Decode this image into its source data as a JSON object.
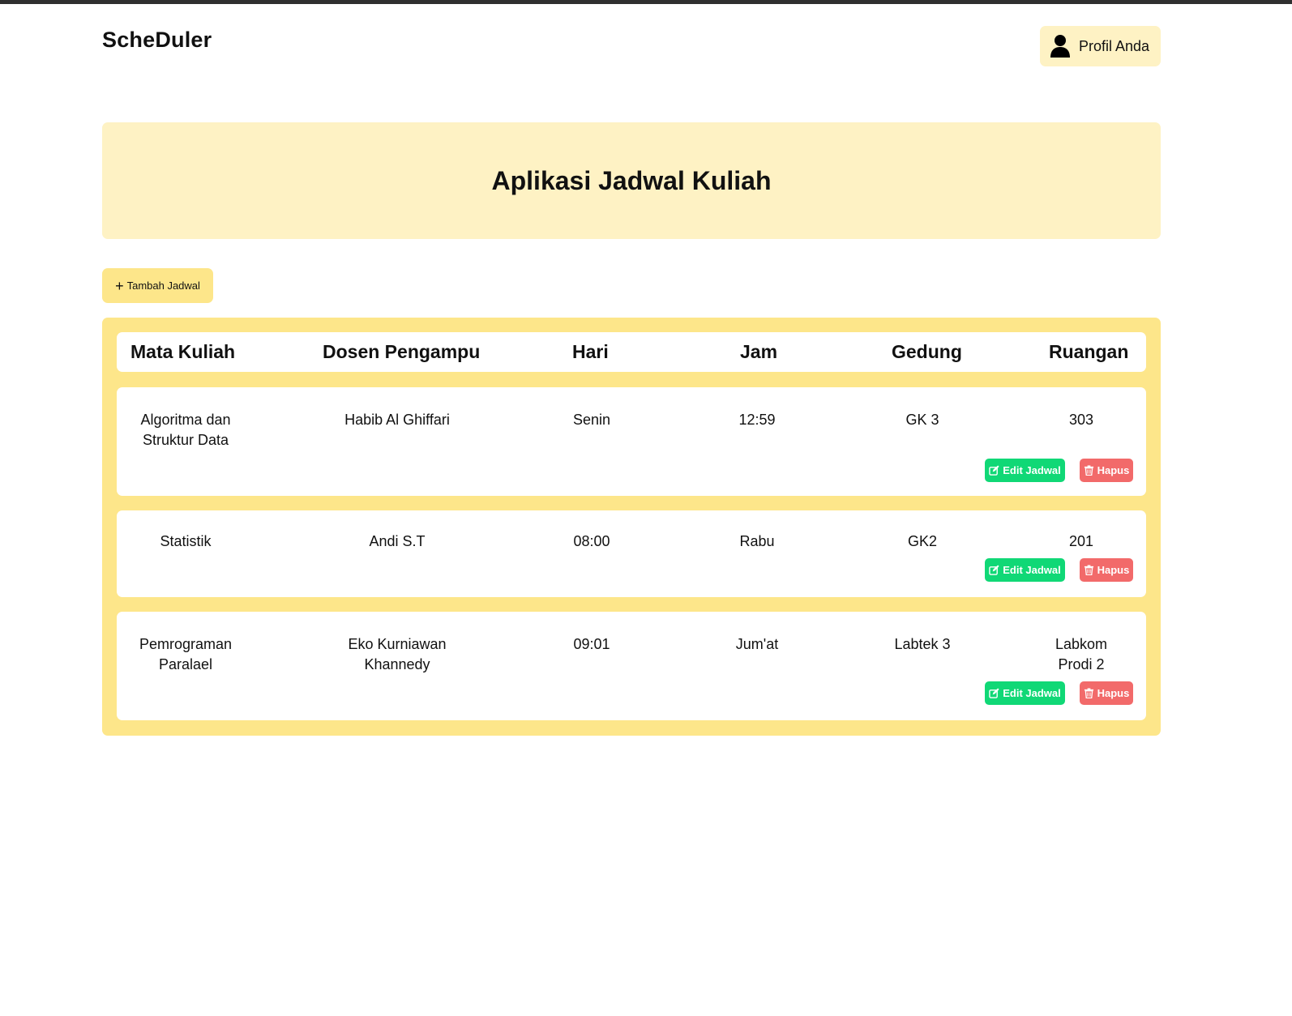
{
  "app": {
    "brand": "ScheDuler",
    "profile_label": "Profil Anda"
  },
  "hero": {
    "title": "Aplikasi Jadwal Kuliah"
  },
  "actions": {
    "add_label": "Tambah Jadwal"
  },
  "table": {
    "headers": [
      "Mata Kuliah",
      "Dosen Pengampu",
      "Hari",
      "Jam",
      "Gedung",
      "Ruangan"
    ],
    "rows": [
      {
        "cells": [
          "Algoritma dan Struktur Data",
          "Habib Al Ghiffari",
          "Senin",
          "12:59",
          "GK 3",
          "303"
        ],
        "edit_label": "Edit Jadwal",
        "delete_label": "Hapus"
      },
      {
        "cells": [
          "Statistik",
          "Andi S.T",
          "08:00",
          "Rabu",
          "GK2",
          "201"
        ],
        "edit_label": "Edit Jadwal",
        "delete_label": "Hapus"
      },
      {
        "cells": [
          "Pemrograman Paralael",
          "Eko Kurniawan Khannedy",
          "09:01",
          "Jum'at",
          "Labtek 3",
          "Labkom Prodi 2"
        ],
        "edit_label": "Edit Jadwal",
        "delete_label": "Hapus"
      }
    ]
  },
  "icons": {
    "profile": "user-icon",
    "add": "plus-icon",
    "edit": "edit-icon",
    "delete": "trash-icon"
  },
  "colors": {
    "hero_bg": "#fef2c4",
    "table_bg": "#fde68a",
    "edit_button": "#10d876",
    "delete_button": "#f26a6a",
    "top_bar": "#2f2f2f"
  }
}
